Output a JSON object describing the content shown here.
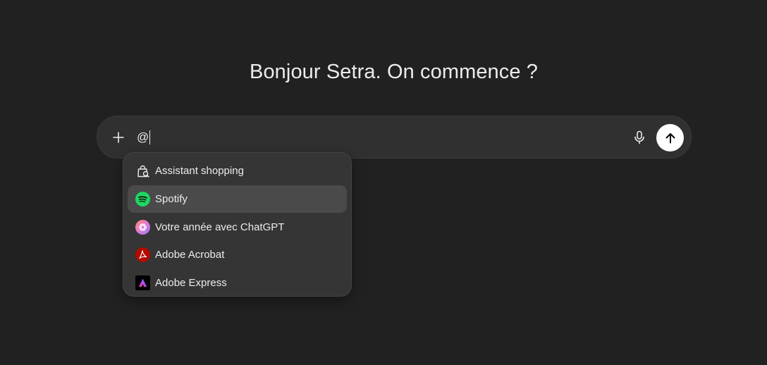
{
  "greeting": "Bonjour Setra. On commence ?",
  "composer": {
    "input_value": "@",
    "icons": {
      "plus": "plus-icon",
      "mic": "microphone-icon",
      "send": "arrow-up-icon"
    }
  },
  "mention_menu": {
    "items": [
      {
        "label": "Assistant shopping",
        "icon": "shopping-bag-search-icon"
      },
      {
        "label": "Spotify",
        "icon": "spotify-icon",
        "highlighted": true
      },
      {
        "label": "Votre année avec ChatGPT",
        "icon": "chatgpt-year-icon"
      },
      {
        "label": "Adobe Acrobat",
        "icon": "adobe-acrobat-icon"
      },
      {
        "label": "Adobe Express",
        "icon": "adobe-express-icon"
      }
    ]
  },
  "colors": {
    "background": "#212121",
    "composer": "#303030",
    "menu": "#353535",
    "menu_highlight": "#4a4a4a",
    "spotify_green": "#1ed760",
    "acrobat_red": "#b30b00"
  }
}
